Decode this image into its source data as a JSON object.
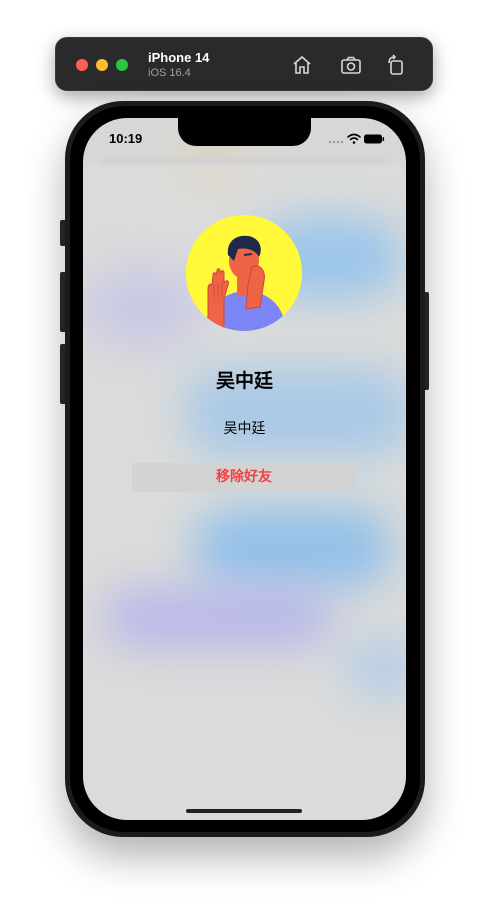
{
  "simulator": {
    "device_name": "iPhone 14",
    "os_version": "iOS 16.4",
    "icons": [
      "home-icon",
      "screenshot-icon",
      "rotate-icon"
    ]
  },
  "statusbar": {
    "time": "10:19",
    "icons": [
      "signal-dots-icon",
      "wifi-icon",
      "battery-icon"
    ]
  },
  "profile": {
    "name": "吴中廷",
    "subtitle": "吴中廷",
    "avatar_icon": "person-avatar-illustration"
  },
  "actions": {
    "remove_friend_label": "移除好友",
    "remove_color": "#ef4444"
  }
}
